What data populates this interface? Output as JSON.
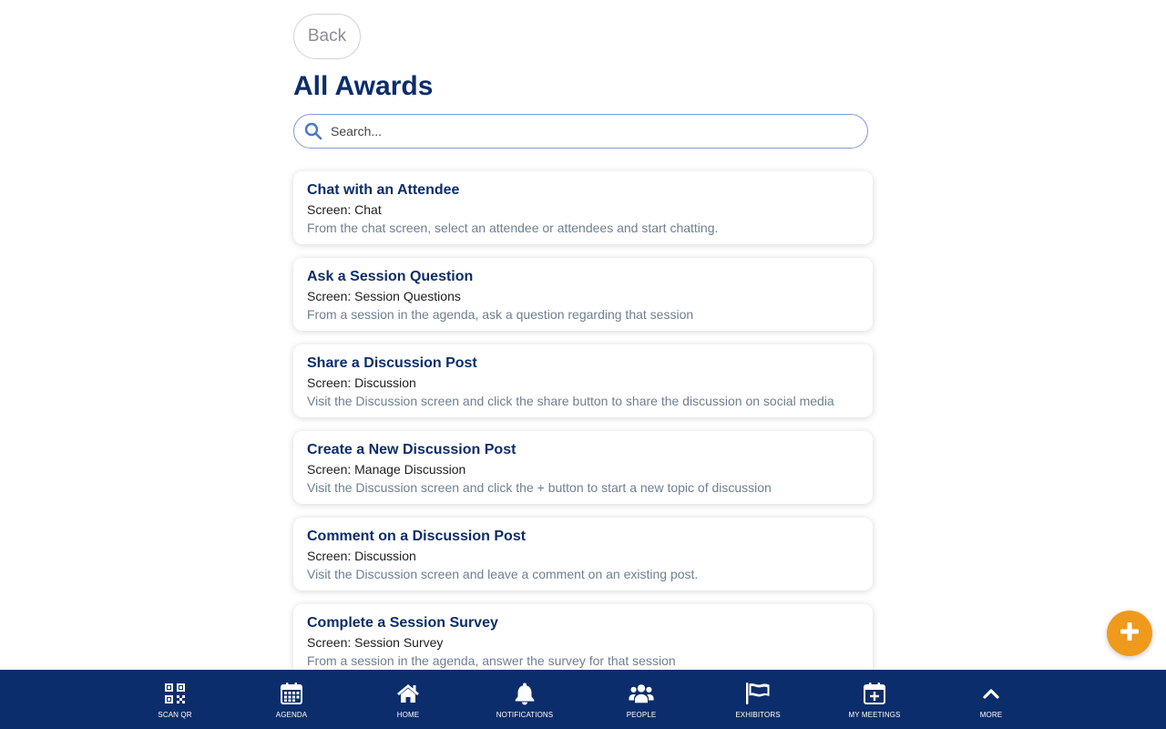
{
  "header": {
    "back_label": "Back",
    "title": "All Awards"
  },
  "search": {
    "placeholder": "Search...",
    "value": ""
  },
  "awards": [
    {
      "title": "Chat with an Attendee",
      "screen": "Screen: Chat",
      "description": "From the chat screen, select an attendee or attendees and start chatting."
    },
    {
      "title": "Ask a Session Question",
      "screen": "Screen: Session Questions",
      "description": "From a session in the agenda, ask a question regarding that session"
    },
    {
      "title": "Share a Discussion Post",
      "screen": "Screen: Discussion",
      "description": "Visit the Discussion screen and click the share button to share the discussion on social media"
    },
    {
      "title": "Create a New Discussion Post",
      "screen": "Screen: Manage Discussion",
      "description": "Visit the Discussion screen and click the + button to start a new topic of discussion"
    },
    {
      "title": "Comment on a Discussion Post",
      "screen": "Screen: Discussion",
      "description": "Visit the Discussion screen and leave a comment on an existing post."
    },
    {
      "title": "Complete a Session Survey",
      "screen": "Screen: Session Survey",
      "description": "From a session in the agenda, answer the survey for that session"
    }
  ],
  "fab": {
    "icon": "plus-icon"
  },
  "nav": {
    "items": [
      {
        "label": "SCAN QR",
        "icon": "qr-code-icon"
      },
      {
        "label": "AGENDA",
        "icon": "calendar-icon"
      },
      {
        "label": "HOME",
        "icon": "home-icon"
      },
      {
        "label": "NOTIFICATIONS",
        "icon": "bell-icon"
      },
      {
        "label": "PEOPLE",
        "icon": "people-icon"
      },
      {
        "label": "EXHIBITORS",
        "icon": "flag-icon"
      },
      {
        "label": "MY MEETINGS",
        "icon": "calendar-plus-icon"
      },
      {
        "label": "MORE",
        "icon": "chevron-up-icon"
      }
    ]
  },
  "colors": {
    "primary": "#0c2d6b",
    "accent": "#ef9a1c",
    "search_border": "#7d9bd6",
    "description_text": "#6e7f92"
  }
}
